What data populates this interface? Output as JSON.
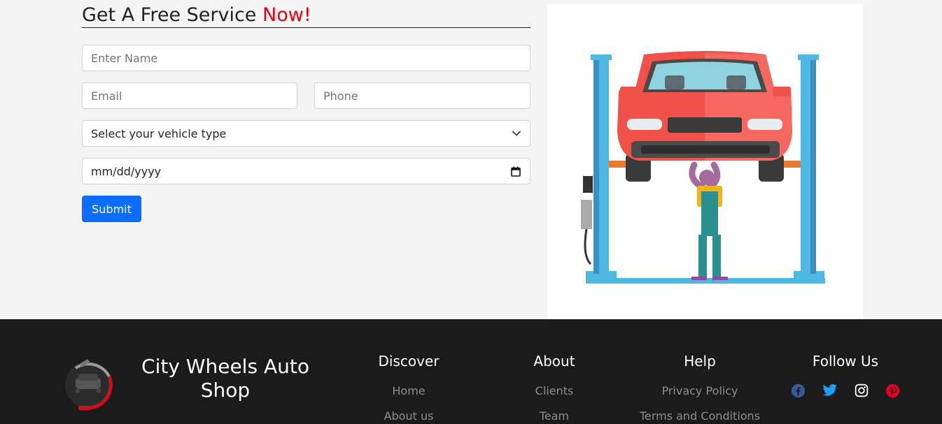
{
  "form": {
    "title": "Get A Free Service ",
    "title_accent": "Now!",
    "name_placeholder": "Enter Name",
    "email_placeholder": "Email",
    "phone_placeholder": "Phone",
    "vehicle_select": "Select your vehicle type",
    "date_placeholder": "mm/dd/yyyy",
    "submit_label": "Submit"
  },
  "footer": {
    "brand": "City Wheels Auto Shop",
    "columns": [
      {
        "title": "Discover",
        "links": [
          "Home",
          "About us"
        ]
      },
      {
        "title": "About",
        "links": [
          "Clients",
          "Team"
        ]
      },
      {
        "title": "Help",
        "links": [
          "Privacy Policy",
          "Terms and Conditions"
        ]
      }
    ],
    "follow_title": "Follow Us",
    "socials": [
      "facebook-icon",
      "twitter-icon",
      "instagram-icon",
      "pinterest-icon"
    ]
  },
  "colors": {
    "accent": "#e8000d",
    "primary_button": "#0d6efd",
    "footer_bg": "#1b1b1b",
    "facebook": "#3b5998",
    "twitter": "#1da1f2",
    "instagram": "#ffffff",
    "pinterest": "#e60023"
  }
}
